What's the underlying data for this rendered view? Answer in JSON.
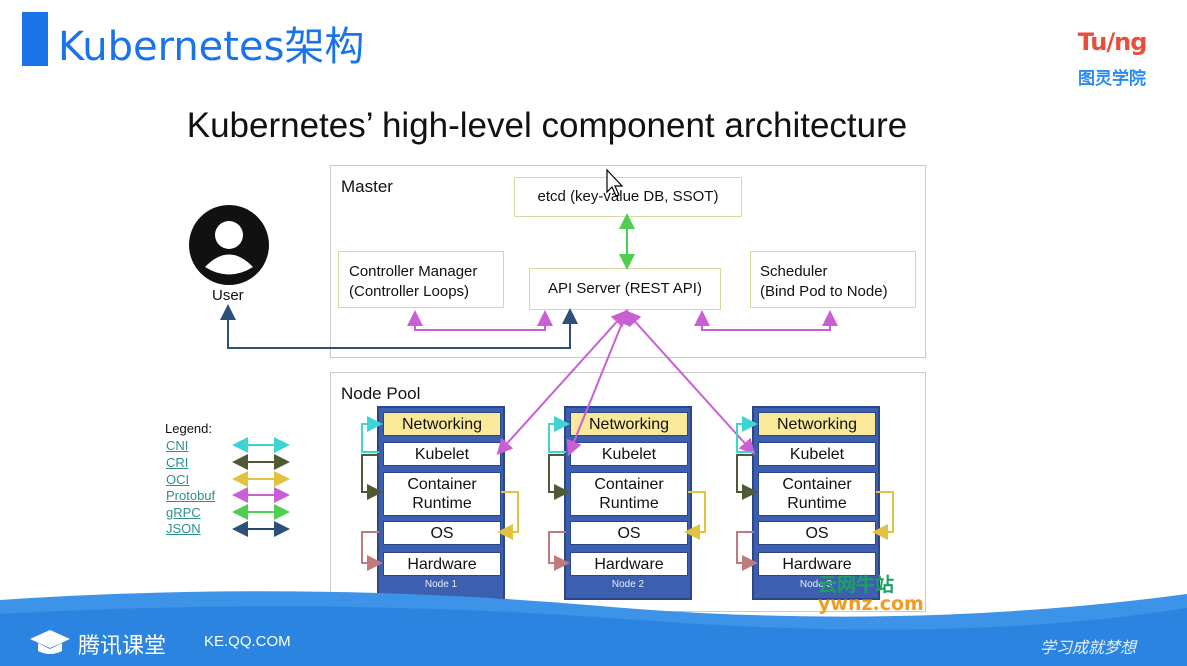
{
  "slide": {
    "title": "Kubernetes架构",
    "brand_logo": "Tu/ng",
    "brand_subtitle": "图灵学院",
    "heading": "Kubernetes’ high-level component architecture"
  },
  "diagram": {
    "master": {
      "label": "Master",
      "etcd": "etcd (key-value DB, SSOT)",
      "controller_manager": [
        "Controller Manager",
        "(Controller Loops)"
      ],
      "api_server": "API Server (REST API)",
      "scheduler": [
        "Scheduler",
        "(Bind Pod to Node)"
      ]
    },
    "user_label": "User",
    "node_pool_label": "Node Pool",
    "nodes": [
      {
        "networking": "Networking",
        "kubelet": "Kubelet",
        "runtime": [
          "Container",
          "Runtime"
        ],
        "os": "OS",
        "hardware": "Hardware",
        "footer": "Node 1"
      },
      {
        "networking": "Networking",
        "kubelet": "Kubelet",
        "runtime": [
          "Container",
          "Runtime"
        ],
        "os": "OS",
        "hardware": "Hardware",
        "footer": "Node 2"
      },
      {
        "networking": "Networking",
        "kubelet": "Kubelet",
        "runtime": [
          "Container",
          "Runtime"
        ],
        "os": "OS",
        "hardware": "Hardware",
        "footer": "Node 3"
      }
    ],
    "legend": {
      "title": "Legend:",
      "items": [
        {
          "label": "CNI",
          "color": "#3fd4d4"
        },
        {
          "label": "CRI",
          "color": "#4f5a34"
        },
        {
          "label": "OCI",
          "color": "#e3c23f"
        },
        {
          "label": "Protobuf",
          "color": "#c85fd3"
        },
        {
          "label": "gRPC",
          "color": "#4fcf4f"
        },
        {
          "label": "JSON",
          "color": "#234a6b"
        }
      ]
    },
    "colors": {
      "grpc": "#4fcf4f",
      "protobuf": "#c85fd3",
      "json": "#2e4f7a",
      "cni": "#3fd4d4",
      "cri": "#4f5a34",
      "oci": "#e3c23f",
      "hw_link": "#c07a7a"
    }
  },
  "watermark": {
    "line1": "云网牛站",
    "line2": "ywnz.com"
  },
  "footer": {
    "brand": "腾讯课堂",
    "url": "KE.QQ.COM",
    "slogan": "学习成就梦想"
  }
}
